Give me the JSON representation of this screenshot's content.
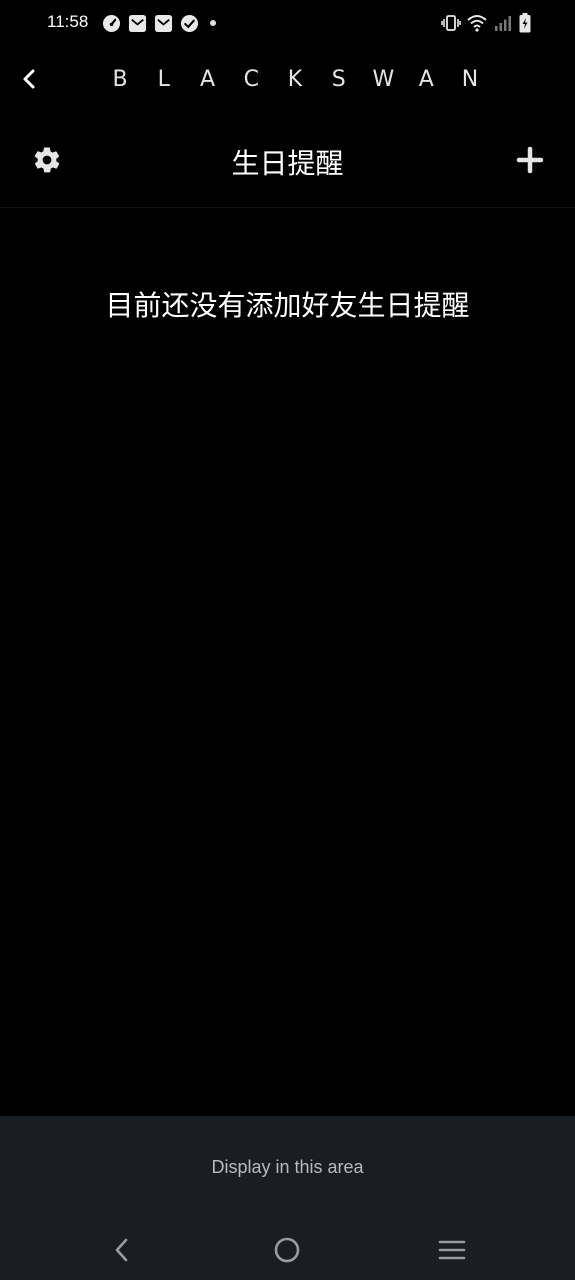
{
  "status_bar": {
    "time": "11:58",
    "left_icons": [
      "speedometer-icon",
      "mail-icon",
      "mail-icon",
      "check-circle-icon",
      "notification-dot"
    ],
    "right_icons": [
      "vibrate-icon",
      "wifi-icon",
      "signal-icon",
      "battery-charging-icon"
    ]
  },
  "header": {
    "back_icon": "chevron-left-icon",
    "brand_letters": [
      "B",
      "L",
      "A",
      "C",
      "K",
      "S",
      "W",
      "A",
      "N"
    ]
  },
  "title_bar": {
    "settings_icon": "gear-icon",
    "title": "生日提醒",
    "add_icon": "plus-icon"
  },
  "main": {
    "empty_message": "目前还没有添加好友生日提醒"
  },
  "ad_area": {
    "text": "Display in this area"
  },
  "system_nav": {
    "back_icon": "nav-back-icon",
    "home_icon": "nav-home-icon",
    "menu_icon": "nav-menu-icon"
  },
  "colors": {
    "background": "#000000",
    "text": "#ffffff",
    "ad_background": "#1b1d24",
    "ad_text": "#b8bac0",
    "nav_icon": "#9a9ca3"
  }
}
